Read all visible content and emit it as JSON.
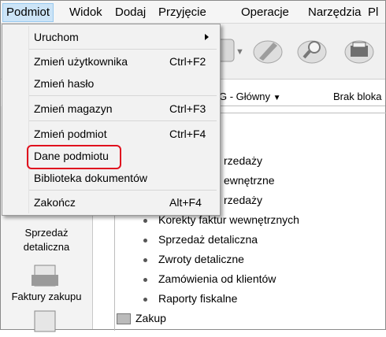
{
  "menubar": {
    "items": [
      "Podmiot",
      "Widok",
      "Dodaj",
      "Przyjęcie",
      "Operacje",
      "Narzędzia",
      "Pl"
    ]
  },
  "infobar": {
    "magazyn": "G - Główny",
    "status": "Brak bloka"
  },
  "dropdown": {
    "items": [
      {
        "label": "Uruchom",
        "shortcut": "",
        "submenu": true
      },
      {
        "label": "Zmień użytkownika",
        "shortcut": "Ctrl+F2"
      },
      {
        "label": "Zmień hasło",
        "shortcut": ""
      },
      {
        "label": "Zmień magazyn",
        "shortcut": "Ctrl+F3"
      },
      {
        "label": "Zmień podmiot",
        "shortcut": "Ctrl+F4"
      },
      {
        "label": "Dane podmiotu",
        "shortcut": "",
        "highlighted": true
      },
      {
        "label": "Biblioteka dokumentów",
        "shortcut": ""
      },
      {
        "label": "Zakończ",
        "shortcut": "Alt+F4"
      }
    ]
  },
  "leftpanel": {
    "items": [
      "Sprzedaż\ndetaliczna",
      "Faktury zakupu"
    ]
  },
  "tree": {
    "partial_items": [
      "rzedaży",
      "ewnętrzne",
      "rzedaży"
    ],
    "items": [
      "Korekty faktur wewnętrznych",
      "Sprzedaż detaliczna",
      "Zwroty detaliczne",
      "Zamówienia od klientów",
      "Raporty fiskalne"
    ],
    "folder": "Zakup"
  },
  "colors": {
    "highlight_border": "#e0101e",
    "menu_active": "#cce4f7"
  }
}
